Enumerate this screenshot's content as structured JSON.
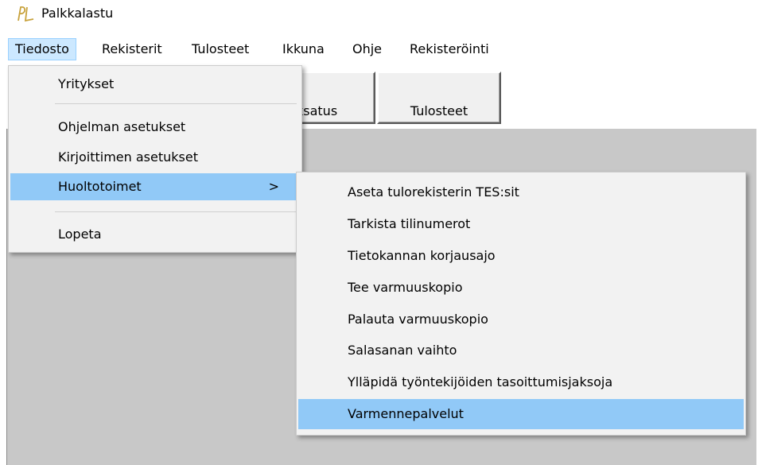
{
  "window": {
    "title": "Palkkalastu"
  },
  "menubar": {
    "items": [
      {
        "label": "Tiedosto"
      },
      {
        "label": "Rekisterit"
      },
      {
        "label": "Tulosteet"
      },
      {
        "label": "Ikkuna"
      },
      {
        "label": "Ohje"
      },
      {
        "label": "Rekisteröinti"
      }
    ]
  },
  "toolbar": {
    "buttons": [
      {
        "label": "ksatus"
      },
      {
        "label": "Tulosteet"
      }
    ]
  },
  "file_menu": {
    "items": [
      {
        "label": "Yritykset"
      },
      {
        "label": "Ohjelman asetukset"
      },
      {
        "label": "Kirjoittimen asetukset"
      },
      {
        "label": "Huoltotoimet",
        "arrow": ">"
      },
      {
        "label": "Lopeta"
      }
    ]
  },
  "submenu": {
    "items": [
      {
        "label": "Aseta tulorekisterin TES:sit"
      },
      {
        "label": "Tarkista tilinumerot"
      },
      {
        "label": "Tietokannan korjausajo"
      },
      {
        "label": "Tee varmuuskopio"
      },
      {
        "label": "Palauta varmuuskopio"
      },
      {
        "label": "Salasanan vaihto"
      },
      {
        "label": "Ylläpidä työntekijöiden tasoittumisjaksoja"
      },
      {
        "label": "Varmennepalvelut"
      }
    ]
  },
  "colors": {
    "menu_highlight": "#91c9f7",
    "menubar_active": "#cce8ff",
    "client_gray": "#c8c8c8",
    "logo_gold": "#c8a23c"
  },
  "icons": {
    "app": "pl-logo-icon",
    "submenu_arrow": "chevron-right-icon"
  }
}
